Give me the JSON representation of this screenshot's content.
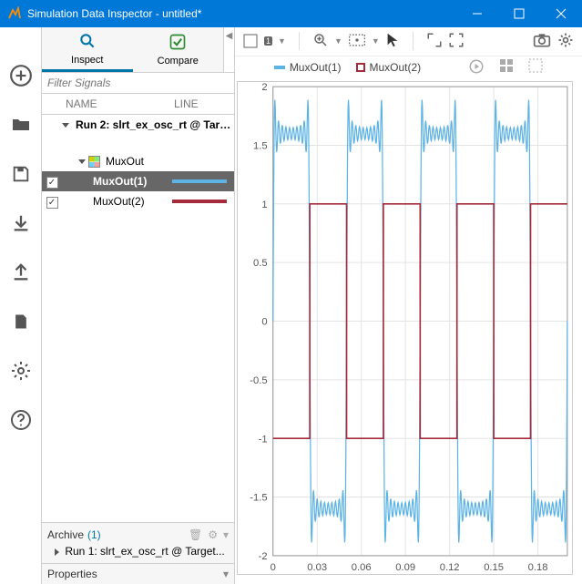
{
  "window": {
    "title": "Simulation Data Inspector - untitled*"
  },
  "tabs": {
    "inspect": "Inspect",
    "compare": "Compare"
  },
  "filter": {
    "placeholder": "Filter Signals"
  },
  "columns": {
    "name": "NAME",
    "line": "LINE"
  },
  "run": {
    "label": "Run 2: slrt_ex_osc_rt @ Target...",
    "group": "MuxOut",
    "signals": [
      {
        "name": "MuxOut(1)",
        "checked": true,
        "color": "#5cb3e4",
        "selected": true
      },
      {
        "name": "MuxOut(2)",
        "checked": true,
        "color": "#a52a3a",
        "selected": false
      }
    ]
  },
  "archive": {
    "label": "Archive",
    "count": "(1)",
    "items": [
      "Run 1: slrt_ex_osc_rt @ Target..."
    ]
  },
  "properties": {
    "label": "Properties"
  },
  "legend": {
    "s1": "MuxOut(1)",
    "s2": "MuxOut(2)"
  },
  "toolbar": {
    "layout_badge": "1"
  },
  "colors": {
    "blue": "#5cb3e4",
    "red": "#a52a3a",
    "accent": "#0076a8"
  },
  "chart_data": {
    "type": "line",
    "xlabel": "",
    "ylabel": "",
    "xlim": [
      0,
      0.2
    ],
    "ylim": [
      -2.0,
      2.0
    ],
    "xticks": [
      0,
      0.03,
      0.06,
      0.09,
      0.12,
      0.15,
      0.18
    ],
    "yticks": [
      -2.0,
      -1.5,
      -1.0,
      -0.5,
      0,
      0.5,
      1.0,
      1.5,
      2.0
    ],
    "series": [
      {
        "name": "MuxOut(1)",
        "color": "#5cb3e4",
        "note": "ringing/Gibbs square wave, period 0.05, amplitude ~1 with overshoot ~2",
        "period": 0.05,
        "amplitude": 1.0,
        "overshoot_peak": 2.05,
        "undershoot_peak": -2.05
      },
      {
        "name": "MuxOut(2)",
        "color": "#a52a3a",
        "note": "ideal square wave, period 0.05, amplitude 1",
        "x": [
          0,
          0.025,
          0.025,
          0.05,
          0.05,
          0.075,
          0.075,
          0.1,
          0.1,
          0.125,
          0.125,
          0.15,
          0.15,
          0.175,
          0.175,
          0.2
        ],
        "y": [
          -1,
          -1,
          1,
          1,
          -1,
          -1,
          1,
          1,
          -1,
          -1,
          1,
          1,
          -1,
          -1,
          1,
          1
        ]
      }
    ]
  }
}
